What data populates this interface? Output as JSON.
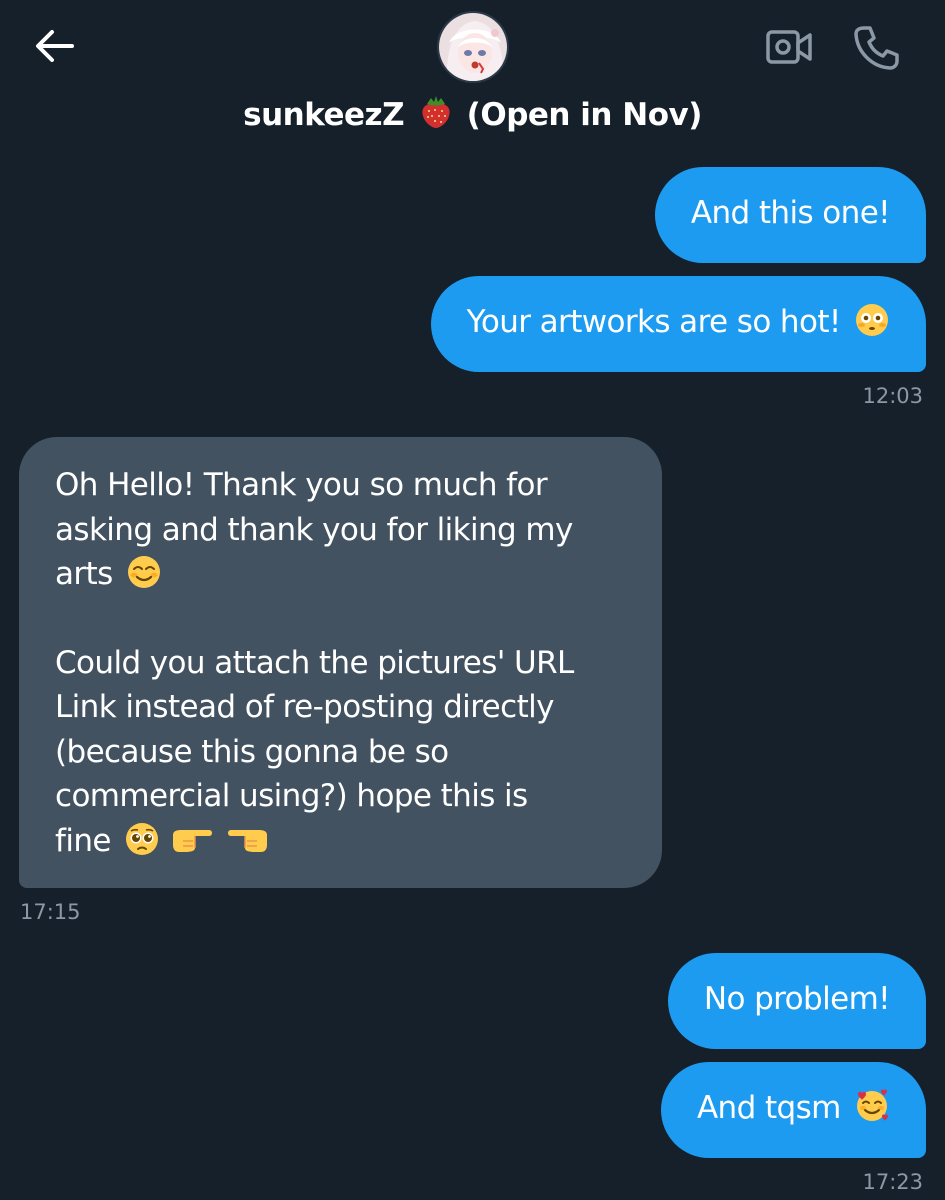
{
  "header": {
    "name": "sunkeezZ",
    "emoji_icon": "strawberry-icon",
    "status": "(Open in Nov)"
  },
  "messages": [
    {
      "direction": "sent",
      "text": "And this one!"
    },
    {
      "direction": "sent",
      "text": "Your artworks are so hot!",
      "emoji": "flushed-face-icon"
    },
    {
      "timestamp": "12:03"
    },
    {
      "direction": "received",
      "lines_para1": [
        "Oh Hello! Thank you so much for",
        "asking and thank you for liking my",
        "arts"
      ],
      "emoji_para1": "smiling-face-icon",
      "lines_para2": [
        "Could you attach the pictures' URL",
        "Link instead of re-posting directly",
        "(because this gonna be so",
        "commercial using?)  hope this is",
        "fine"
      ],
      "emoji_para2": [
        "pleading-face-icon",
        "pointing-right-icon",
        "pointing-left-icon"
      ]
    },
    {
      "timestamp": "17:15"
    },
    {
      "direction": "sent",
      "text": "No problem!"
    },
    {
      "direction": "sent",
      "text": "And tqsm",
      "emoji": "smiling-face-with-hearts-icon"
    },
    {
      "timestamp": "17:23"
    }
  ],
  "colors": {
    "background": "#15202b",
    "sent_bubble": "#1d9bf0",
    "received_bubble": "#435260",
    "timestamp": "#8b98a5"
  }
}
